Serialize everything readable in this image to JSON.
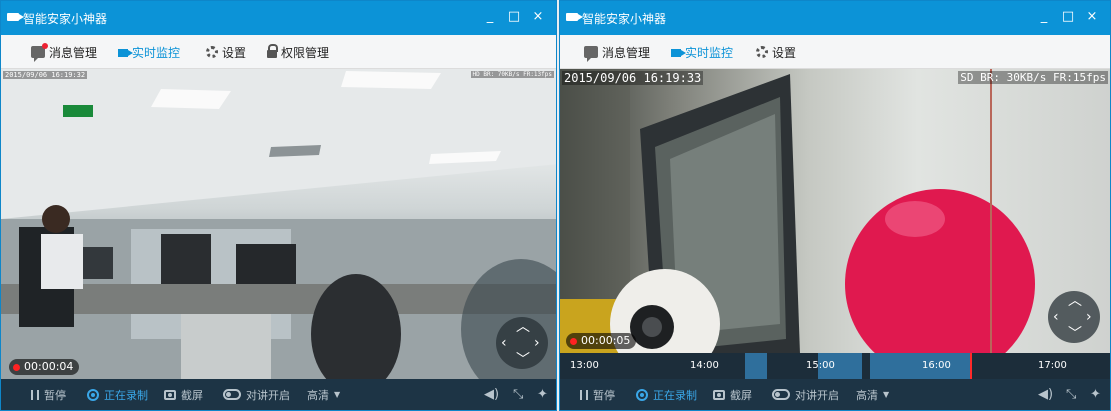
{
  "windows": [
    {
      "title": "智能安家小神器",
      "controls": {
        "minimize": "_",
        "maximize": "□",
        "close": "×"
      },
      "toolbar": [
        {
          "label": "消息管理",
          "icon": "message-icon",
          "active": false,
          "badge": true
        },
        {
          "label": "实时监控",
          "icon": "camera-icon",
          "active": true
        },
        {
          "label": "设置",
          "icon": "gear-icon",
          "active": false
        },
        {
          "label": "权限管理",
          "icon": "lock-icon",
          "active": false
        }
      ],
      "video": {
        "osd_time": "2015/09/06 16:19:32",
        "osd_rate": "HD BR: 70KB/s FR:13fps",
        "rec_time": "00:00:04"
      },
      "controlbar": {
        "pause": "暂停",
        "recording": "正在录制",
        "screenshot": "截屏",
        "intercom": "对讲开启",
        "quality": "高清"
      }
    },
    {
      "title": "智能安家小神器",
      "controls": {
        "minimize": "_",
        "maximize": "□",
        "close": "×"
      },
      "toolbar": [
        {
          "label": "消息管理",
          "icon": "message-icon",
          "active": false
        },
        {
          "label": "实时监控",
          "icon": "camera-icon",
          "active": true
        },
        {
          "label": "设置",
          "icon": "gear-icon",
          "active": false
        }
      ],
      "video": {
        "osd_time": "2015/09/06 16:19:33",
        "osd_rate": "SD BR:  30KB/s FR:15fps",
        "rec_time": "00:00:05"
      },
      "timeline": {
        "labels": [
          "13:00",
          "14:00",
          "15:00",
          "16:00",
          "17:00"
        ]
      },
      "controlbar": {
        "pause": "暂停",
        "recording": "正在录制",
        "screenshot": "截屏",
        "intercom": "对讲开启",
        "quality": "高清"
      }
    }
  ],
  "colors": {
    "title_bar": "#0c93d7",
    "accent": "#0c93d7",
    "control_bar": "#1d3445",
    "recording": "#3aa7e8",
    "rec_dot": "#ff2222"
  }
}
